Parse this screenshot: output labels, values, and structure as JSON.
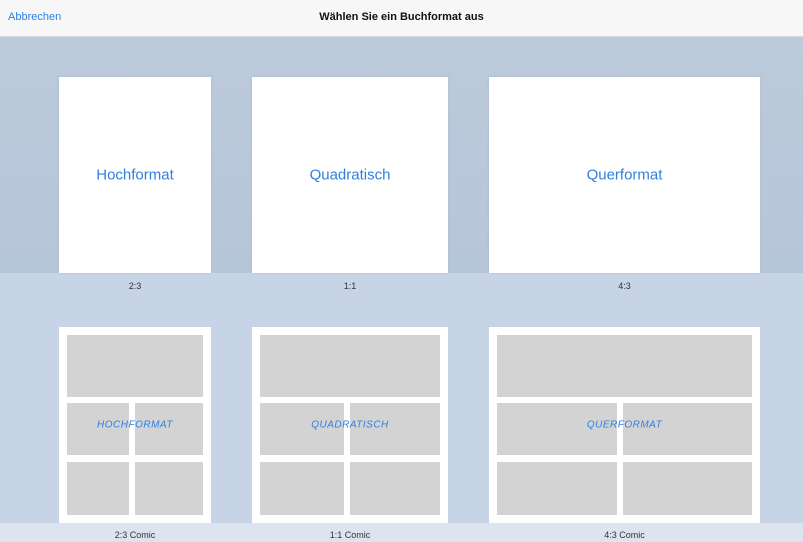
{
  "nav": {
    "cancel_label": "Abbrechen",
    "title": "Wählen Sie ein Buchformat aus"
  },
  "formats": [
    {
      "label": "Hochformat",
      "ratio": "2:3"
    },
    {
      "label": "Quadratisch",
      "ratio": "1:1"
    },
    {
      "label": "Querformat",
      "ratio": "4:3"
    }
  ],
  "comics": [
    {
      "label": "HOCHFORMAT",
      "ratio": "2:3 Comic"
    },
    {
      "label": "QUADRATISCH",
      "ratio": "1:1 Comic"
    },
    {
      "label": "QUERFORMAT",
      "ratio": "4:3 Comic"
    }
  ],
  "colors": {
    "accent": "#2f7fe0"
  }
}
